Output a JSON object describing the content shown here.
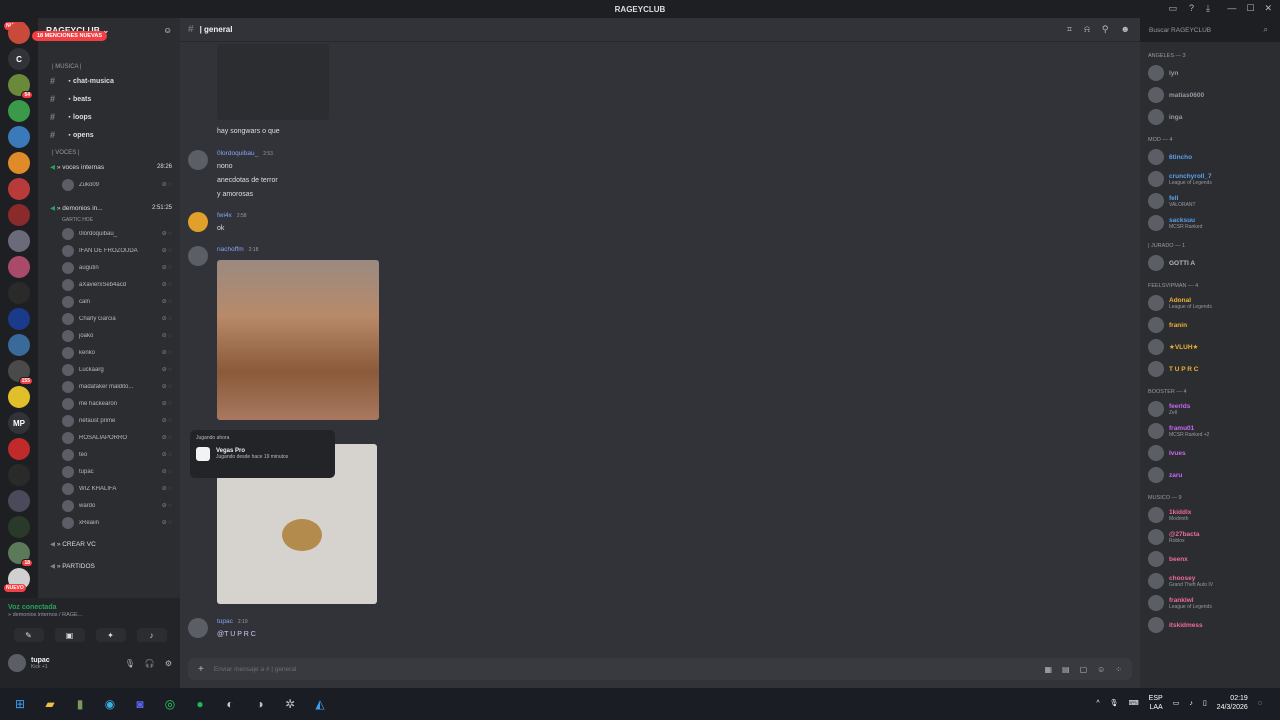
{
  "window": {
    "title": "RAGEYCLUB",
    "min": "—",
    "max": "☐",
    "close": "✕"
  },
  "servers": [
    {
      "label": "",
      "badge": "",
      "color": "#c94a3a"
    },
    {
      "label": "C",
      "badge": "",
      "color": "#313338"
    },
    {
      "label": "",
      "badge": "54",
      "color": "#6a8a3a"
    },
    {
      "label": "",
      "badge": "",
      "color": "#3a9a4a"
    },
    {
      "label": "",
      "badge": "",
      "color": "#3a7aba"
    },
    {
      "label": "",
      "badge": "",
      "color": "#e08a2a"
    },
    {
      "label": "",
      "badge": "",
      "color": "#b83a3a"
    },
    {
      "label": "",
      "badge": "",
      "color": "#8a2a2a"
    },
    {
      "label": "",
      "badge": "",
      "color": "#6a6a7a"
    },
    {
      "label": "",
      "badge": "",
      "color": "#aa4a6a"
    },
    {
      "label": "",
      "badge": "",
      "color": "#2a2a2a"
    },
    {
      "label": "",
      "badge": "",
      "color": "#1a3a8a"
    },
    {
      "label": "",
      "badge": "",
      "color": "#3a6a9a"
    },
    {
      "label": "",
      "badge": "155",
      "color": "#4a4a4a"
    },
    {
      "label": "",
      "badge": "",
      "color": "#e0c02a"
    },
    {
      "label": "MP",
      "badge": "",
      "color": "#313338"
    },
    {
      "label": "",
      "badge": "",
      "color": "#c02a2a"
    },
    {
      "label": "",
      "badge": "",
      "color": "#2a2a2a"
    },
    {
      "label": "",
      "badge": "",
      "color": "#4a4a5a"
    },
    {
      "label": "",
      "badge": "",
      "color": "#2a3a2a"
    },
    {
      "label": "",
      "badge": "18",
      "color": "#5a7a5a"
    },
    {
      "label": "",
      "badge": "",
      "color": "#d0d0d0"
    }
  ],
  "nuevo": "NUEVO",
  "server": {
    "name": "RAGEYCLUB",
    "chevron": "⌄"
  },
  "mentions": "18 MENCIONES NUEVAS",
  "categories": {
    "musica": "| MUSICA |",
    "voces": "| VOCES |"
  },
  "text_channels": [
    {
      "name": "・chat-musica"
    },
    {
      "name": "・beats"
    },
    {
      "name": "・loops"
    },
    {
      "name": "・opens"
    }
  ],
  "voice_channels": {
    "internas": {
      "name": "» voces internas",
      "timer": "28:26"
    },
    "demonios": {
      "name": "» demonios in...",
      "timer": "2:51:25",
      "sub": "GARTIC HOE"
    }
  },
  "internas_users": [
    {
      "name": "Zuko09"
    }
  ],
  "demonios_users": [
    {
      "name": "0lordoquibau_"
    },
    {
      "name": "IFAN DE FROZOUDA"
    },
    {
      "name": "augutin"
    },
    {
      "name": "aXavierxSeb4acd"
    },
    {
      "name": "caln"
    },
    {
      "name": "Charly Garcia"
    },
    {
      "name": "joako"
    },
    {
      "name": "kenko"
    },
    {
      "name": "Luckaarg"
    },
    {
      "name": "madafaker maldito..."
    },
    {
      "name": "me hackearon"
    },
    {
      "name": "nefaust prime"
    },
    {
      "name": "ROSALIAPORRO"
    },
    {
      "name": "teo"
    },
    {
      "name": "tupac"
    },
    {
      "name": "WIZ KHALIFA"
    },
    {
      "name": "wardo"
    },
    {
      "name": "xReaiin"
    }
  ],
  "extra_voice": [
    {
      "name": "» CREAR VC"
    },
    {
      "name": "» PARTIDOS"
    }
  ],
  "voice_panel": {
    "status": "Voz conectada",
    "sub": "» demonios internos / RAGE..."
  },
  "user": {
    "name": "tupac",
    "status": "Kick +1"
  },
  "chat": {
    "channel": "| general"
  },
  "messages": {
    "m0_line": "hay songwars o que",
    "m1_author": "0lordoquibau_",
    "m1_ts": "2:53",
    "m1_lines": [
      "nono",
      "anecdotas de terror",
      "y amorosas"
    ],
    "m2_author": "fwi4x",
    "m2_ts": "2:58",
    "m2_line": "ok",
    "m3_author": "nachoffm",
    "m3_ts": "2:18",
    "m4_author": "tupac",
    "m4_ts": "2:19",
    "m4_line": "@T U P R C"
  },
  "presence": {
    "label": "Jugando ahora",
    "game": "Vegas Pro",
    "time": "Jugando desde hace 19 minutos"
  },
  "composer": {
    "placeholder": "Enviar mensaje a #  | general"
  },
  "search": {
    "placeholder": "Buscar RAGEYCLUB"
  },
  "member_groups": [
    {
      "title": "ANGELES — 3",
      "members": [
        {
          "name": "lyn",
          "status": "",
          "color": "#949ba4"
        },
        {
          "name": "matias0600",
          "status": "",
          "color": "#949ba4"
        },
        {
          "name": "inga",
          "status": "",
          "color": "#949ba4"
        }
      ]
    },
    {
      "title": "Mod — 4",
      "members": [
        {
          "name": "6tincho",
          "status": "",
          "color": "#5ba0f0"
        },
        {
          "name": "crunchyroll_7",
          "status": "League of Legends",
          "color": "#5ba0f0"
        },
        {
          "name": "fell",
          "status": "VALORANT",
          "color": "#5ba0f0"
        },
        {
          "name": "sacksuu",
          "status": "MCSR Ranked",
          "color": "#5ba0f0"
        }
      ]
    },
    {
      "title": "| Jurado — 1",
      "members": [
        {
          "name": "GOTTI A",
          "status": "",
          "color": "#b5bac1"
        }
      ]
    },
    {
      "title": "FeelsVipMan — 4",
      "members": [
        {
          "name": "Adonal",
          "status": "League of Legends",
          "color": "#f0b232"
        },
        {
          "name": "franin",
          "status": "",
          "color": "#f0b232"
        },
        {
          "name": "★VLUH★",
          "status": "",
          "color": "#f0b232"
        },
        {
          "name": "T U P R C",
          "status": "",
          "color": "#f0b232"
        }
      ]
    },
    {
      "title": "Booster — 4",
      "members": [
        {
          "name": "feerlds",
          "status": "Zell",
          "color": "#c46bf0"
        },
        {
          "name": "framu01",
          "status": "MCSR Ranked +2",
          "color": "#c46bf0"
        },
        {
          "name": "Ivues",
          "status": "",
          "color": "#c46bf0"
        },
        {
          "name": "zaru",
          "status": "",
          "color": "#c46bf0"
        }
      ]
    },
    {
      "title": "Musico — 9",
      "members": [
        {
          "name": "1kiddix",
          "status": "Modrinth",
          "color": "#f06b9a"
        },
        {
          "name": "@27bacta",
          "status": "Roblox",
          "color": "#f06b9a"
        },
        {
          "name": "beenx",
          "status": "",
          "color": "#f06b9a"
        },
        {
          "name": "choosey",
          "status": "Grand Theft Auto IV",
          "color": "#f06b9a"
        },
        {
          "name": "franklwl",
          "status": "League of Legends",
          "color": "#f06b9a"
        },
        {
          "name": "itskidmess",
          "status": "",
          "color": "#f06b9a"
        }
      ]
    }
  ],
  "taskbar": {
    "lang": "ESP",
    "lang2": "LAA",
    "time": "02:19",
    "date": "24/3/2026"
  },
  "colors": {
    "accent": "#5865f2",
    "danger": "#f23f43",
    "online": "#23a55a"
  }
}
